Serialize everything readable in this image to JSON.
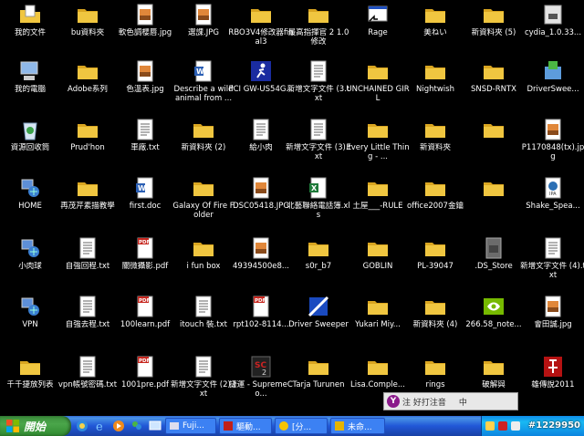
{
  "desktop": {
    "icons": [
      {
        "label": "我的文件",
        "icon": "my-documents"
      },
      {
        "label": "bu資料夾",
        "icon": "folder"
      },
      {
        "label": "軟色調櫻唇.jpg",
        "icon": "image"
      },
      {
        "label": "選課.JPG",
        "icon": "image"
      },
      {
        "label": "RBO3V4修改器final3",
        "icon": "folder"
      },
      {
        "label": "最高指揮官 2 1.0修改",
        "icon": "folder"
      },
      {
        "label": "Rage",
        "icon": "shortcut-app"
      },
      {
        "label": "美ねい",
        "icon": "folder"
      },
      {
        "label": "新資料夾 (5)",
        "icon": "folder"
      },
      {
        "label": "cydia_1.0.33...",
        "icon": "disk"
      },
      {
        "label": "我的電腦",
        "icon": "my-computer"
      },
      {
        "label": "Adobe系列",
        "icon": "folder"
      },
      {
        "label": "色溫表.jpg",
        "icon": "image"
      },
      {
        "label": "Describe a wild animal from ...",
        "icon": "word-doc"
      },
      {
        "label": "PCI GW-US54G...",
        "icon": "runner-app"
      },
      {
        "label": "新增文字文件 (3.txt",
        "icon": "text-file"
      },
      {
        "label": "UNCHAINED GIRL",
        "icon": "folder"
      },
      {
        "label": "Nightwish",
        "icon": "folder"
      },
      {
        "label": "SNSD-RNTX",
        "icon": "folder"
      },
      {
        "label": "DriverSwee...",
        "icon": "installer"
      },
      {
        "label": "資源回收筒",
        "icon": "recycle-bin"
      },
      {
        "label": "Prud'hon",
        "icon": "folder"
      },
      {
        "label": "車廠.txt",
        "icon": "text-file"
      },
      {
        "label": "新資料夾 (2)",
        "icon": "folder"
      },
      {
        "label": "給小肉",
        "icon": "text-file"
      },
      {
        "label": "新增文字文件 (3).txt",
        "icon": "text-file"
      },
      {
        "label": "Every Little Thing - ...",
        "icon": "folder"
      },
      {
        "label": "新資料夾",
        "icon": "folder"
      },
      {
        "label": "",
        "icon": "folder"
      },
      {
        "label": "P1170848(tx).jpg",
        "icon": "image"
      },
      {
        "label": "HOME",
        "icon": "network-shortcut"
      },
      {
        "label": "再茂芹素描教學",
        "icon": "folder"
      },
      {
        "label": "first.doc",
        "icon": "word-doc"
      },
      {
        "label": "Galaxy Of Fire Folder",
        "icon": "folder"
      },
      {
        "label": "DSC05418.JPG",
        "icon": "image"
      },
      {
        "label": "北藝聯絡電話簿.xls",
        "icon": "excel-doc"
      },
      {
        "label": "土屋___-RULE",
        "icon": "folder"
      },
      {
        "label": "office2007金鑰",
        "icon": "folder"
      },
      {
        "label": "",
        "icon": "folder"
      },
      {
        "label": "Shake_Spea...",
        "icon": "ipa-file"
      },
      {
        "label": "小肉球",
        "icon": "network-shortcut"
      },
      {
        "label": "自強回程.txt",
        "icon": "text-file"
      },
      {
        "label": "關微攝影.pdf",
        "icon": "pdf"
      },
      {
        "label": "i fun box",
        "icon": "folder"
      },
      {
        "label": "49394500e8...",
        "icon": "image"
      },
      {
        "label": "s0r_b7",
        "icon": "folder"
      },
      {
        "label": "GOBLIN",
        "icon": "folder"
      },
      {
        "label": "PL-39047",
        "icon": "folder"
      },
      {
        "label": ".DS_Store",
        "icon": "generic-file"
      },
      {
        "label": "新增文字文件 (4).txt",
        "icon": "text-file"
      },
      {
        "label": "VPN",
        "icon": "network-shortcut"
      },
      {
        "label": "自強去程.txt",
        "icon": "text-file"
      },
      {
        "label": "100learn.pdf",
        "icon": "pdf"
      },
      {
        "label": "itouch 裝.txt",
        "icon": "text-file"
      },
      {
        "label": "rpt102-8114...",
        "icon": "pdf"
      },
      {
        "label": "Driver Sweeper",
        "icon": "driver-sweeper"
      },
      {
        "label": "Yukari Miy...",
        "icon": "folder"
      },
      {
        "label": "新資料夾 (4)",
        "icon": "folder"
      },
      {
        "label": "266.58_note...",
        "icon": "nvidia"
      },
      {
        "label": "會田誠.jpg",
        "icon": "image"
      },
      {
        "label": "千千捷放列表",
        "icon": "folder"
      },
      {
        "label": "vpn帳號密碼.txt",
        "icon": "text-file"
      },
      {
        "label": "1001pre.pdf",
        "icon": "pdf"
      },
      {
        "label": "新增文字文件 (2).txt",
        "icon": "text-file"
      },
      {
        "label": "捷運 - SupremeCo...",
        "icon": "sc2-app"
      },
      {
        "label": "Tarja Turunen",
        "icon": "folder"
      },
      {
        "label": "Lisa.Comple...",
        "icon": "folder"
      },
      {
        "label": "rings",
        "icon": "folder"
      },
      {
        "label": "破解與",
        "icon": "folder"
      },
      {
        "label": "雄傳說2011",
        "icon": "game-red"
      }
    ]
  },
  "ime_bar": {
    "text": "注 好打注音",
    "mode": "中"
  },
  "taskbar": {
    "start_label": "開始",
    "buttons": [
      {
        "label": "Fuji..."
      },
      {
        "label": "驅動..."
      },
      {
        "label": "[分..."
      },
      {
        "label": "未命..."
      }
    ],
    "watermark": "#1229950"
  },
  "colors": {
    "folder": "#f0c640",
    "taskbar": "#245edb",
    "start": "#3c9a3c",
    "label": "#ffffff"
  }
}
